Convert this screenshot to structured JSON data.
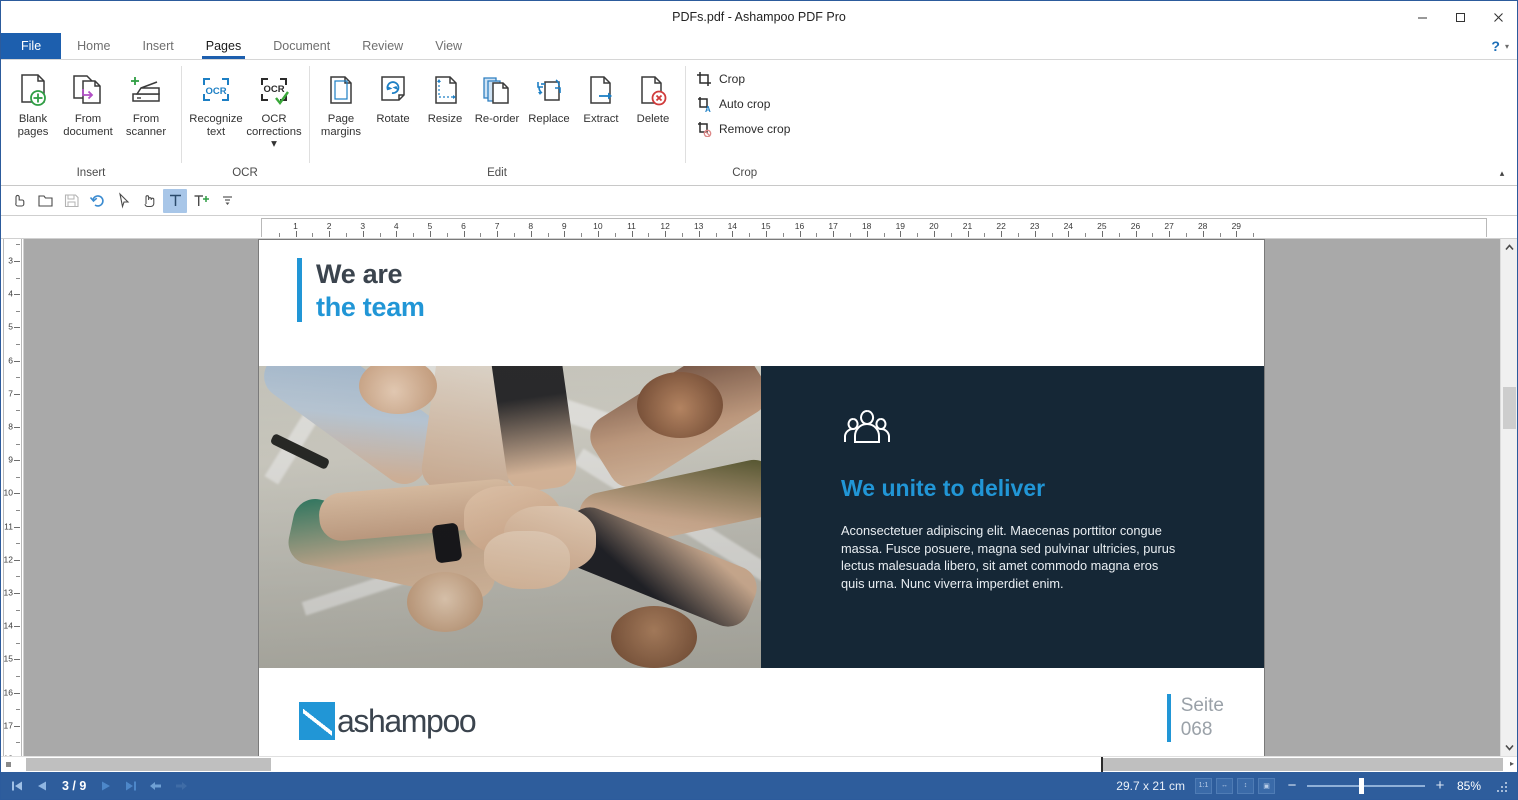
{
  "window": {
    "title": "PDFs.pdf - Ashampoo PDF Pro",
    "minimize": "minimize-button",
    "maximize": "maximize-button",
    "close": "close-button"
  },
  "tabs": [
    {
      "label": "File",
      "active": false,
      "file": true
    },
    {
      "label": "Home",
      "active": false
    },
    {
      "label": "Insert",
      "active": false
    },
    {
      "label": "Pages",
      "active": true
    },
    {
      "label": "Document",
      "active": false
    },
    {
      "label": "Review",
      "active": false
    },
    {
      "label": "View",
      "active": false
    }
  ],
  "help": {
    "label": "?",
    "caret": "▾"
  },
  "ribbon": {
    "collapse": "▴",
    "groups": [
      {
        "label": "Insert",
        "buttons": [
          {
            "label": "Blank\npages",
            "icon": "blank-pages-icon"
          },
          {
            "label": "From\ndocument",
            "icon": "from-document-icon"
          },
          {
            "label": "From\nscanner",
            "icon": "from-scanner-icon"
          }
        ]
      },
      {
        "label": "OCR",
        "buttons": [
          {
            "label": "Recognize\ntext",
            "icon": "ocr-recognize-icon"
          },
          {
            "label": "OCR\ncorrections ▾",
            "icon": "ocr-corrections-icon"
          }
        ]
      },
      {
        "label": "Edit",
        "buttons": [
          {
            "label": "Page\nmargins",
            "icon": "page-margins-icon"
          },
          {
            "label": "Rotate",
            "icon": "rotate-icon"
          },
          {
            "label": "Resize",
            "icon": "resize-icon"
          },
          {
            "label": "Re-order",
            "icon": "reorder-icon"
          },
          {
            "label": "Replace",
            "icon": "replace-icon"
          },
          {
            "label": "Extract",
            "icon": "extract-icon"
          },
          {
            "label": "Delete",
            "icon": "delete-icon"
          }
        ]
      },
      {
        "label": "Crop",
        "buttons": [
          {
            "label": "Crop",
            "icon": "crop-icon"
          },
          {
            "label": "Auto crop",
            "icon": "auto-crop-icon"
          },
          {
            "label": "Remove crop",
            "icon": "remove-crop-icon"
          }
        ]
      }
    ]
  },
  "quick_toolbar": [
    {
      "name": "touch-mode-icon",
      "selected": false
    },
    {
      "name": "open-folder-icon",
      "selected": false
    },
    {
      "name": "save-icon",
      "selected": false
    },
    {
      "name": "undo-icon",
      "selected": false
    },
    {
      "name": "select-arrow-icon",
      "selected": false
    },
    {
      "name": "hand-tool-icon",
      "selected": false
    },
    {
      "name": "text-tool-icon",
      "selected": true
    },
    {
      "name": "add-text-icon",
      "selected": false
    },
    {
      "name": "toolbar-overflow-icon",
      "selected": false
    }
  ],
  "ruler": {
    "unit": "cm",
    "horizontal_max": 29,
    "vertical_start": 3,
    "vertical_end": 18
  },
  "document": {
    "heading_line1": "We are",
    "heading_line2": "the team",
    "hero": {
      "icon": "three-people-icon",
      "title": "We unite to deliver",
      "body": "Aconsectetuer adipiscing elit. Maecenas porttitor congue massa. Fusce posuere, magna sed pulvinar ultricies, purus lectus malesuada libero, sit amet commodo magna eros quis urna. Nunc viverra imperdiet enim."
    },
    "footer": {
      "logo_text": "ashampoo",
      "page_label": "Seite",
      "page_number": "068"
    }
  },
  "status": {
    "first_page": "first-page-button",
    "prev_page": "previous-page-button",
    "page_indicator": "3 / 9",
    "next_page": "next-page-button",
    "last_page": "last-page-button",
    "back": "navigate-back-button",
    "forward": "navigate-forward-button",
    "dimensions": "29.7 x 21 cm",
    "view_modes": [
      {
        "name": "zoom-actual-size-button",
        "label": "1:1"
      },
      {
        "name": "fit-width-button",
        "label": "↔"
      },
      {
        "name": "fit-page-button",
        "label": "↕"
      },
      {
        "name": "dual-page-button",
        "label": "▣"
      }
    ],
    "zoom_out": "−",
    "zoom_in": "+",
    "zoom_value": "85%"
  },
  "colors": {
    "accent_blue": "#2196d6",
    "ribbon_blue": "#1d5fae",
    "status_blue": "#2e5d9c",
    "dark_panel": "#152736",
    "heading_gray": "#3b444e"
  }
}
